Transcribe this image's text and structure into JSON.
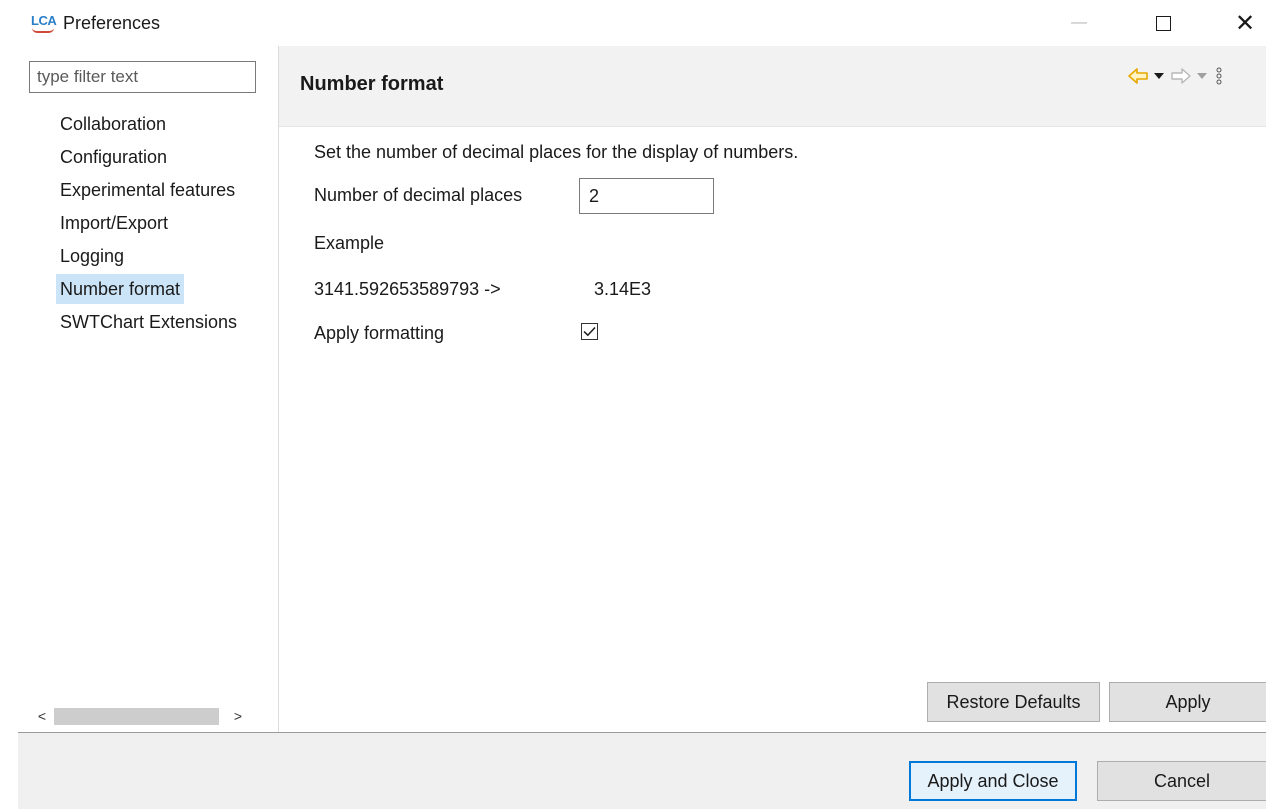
{
  "window": {
    "app_logo": "LCA",
    "title": "Preferences",
    "controls": {
      "minimize": "—",
      "close": "✕"
    }
  },
  "sidebar": {
    "filter_placeholder": "type filter text",
    "items": [
      {
        "label": "Collaboration",
        "selected": false
      },
      {
        "label": "Configuration",
        "selected": false
      },
      {
        "label": "Experimental features",
        "selected": false
      },
      {
        "label": "Import/Export",
        "selected": false
      },
      {
        "label": "Logging",
        "selected": false
      },
      {
        "label": "Number format",
        "selected": true
      },
      {
        "label": "SWTChart Extensions",
        "selected": false
      }
    ],
    "scroll": {
      "left": "<",
      "right": ">"
    }
  },
  "page": {
    "title": "Number format",
    "description": "Set the number of decimal places for the display of numbers.",
    "decimal_places_label": "Number of decimal places",
    "decimal_places_value": "2",
    "example_label": "Example",
    "example_input": "3141.592653589793 ->",
    "example_output": "3.14E3",
    "apply_formatting_label": "Apply formatting",
    "apply_formatting_checked": true,
    "restore_defaults_label": "Restore Defaults",
    "apply_label": "Apply"
  },
  "footer": {
    "apply_close_label": "Apply and Close",
    "cancel_label": "Cancel"
  },
  "colors": {
    "selection": "#cce4f7",
    "header_bg": "#f2f2f2",
    "footer_bg": "#f0f0f0",
    "default_button_border": "#0078d7",
    "back_arrow": "#e8a800"
  },
  "icons": [
    "app-logo-icon",
    "back-arrow-icon",
    "dropdown-icon",
    "forward-arrow-icon",
    "view-menu-icon",
    "checkmark-icon"
  ]
}
